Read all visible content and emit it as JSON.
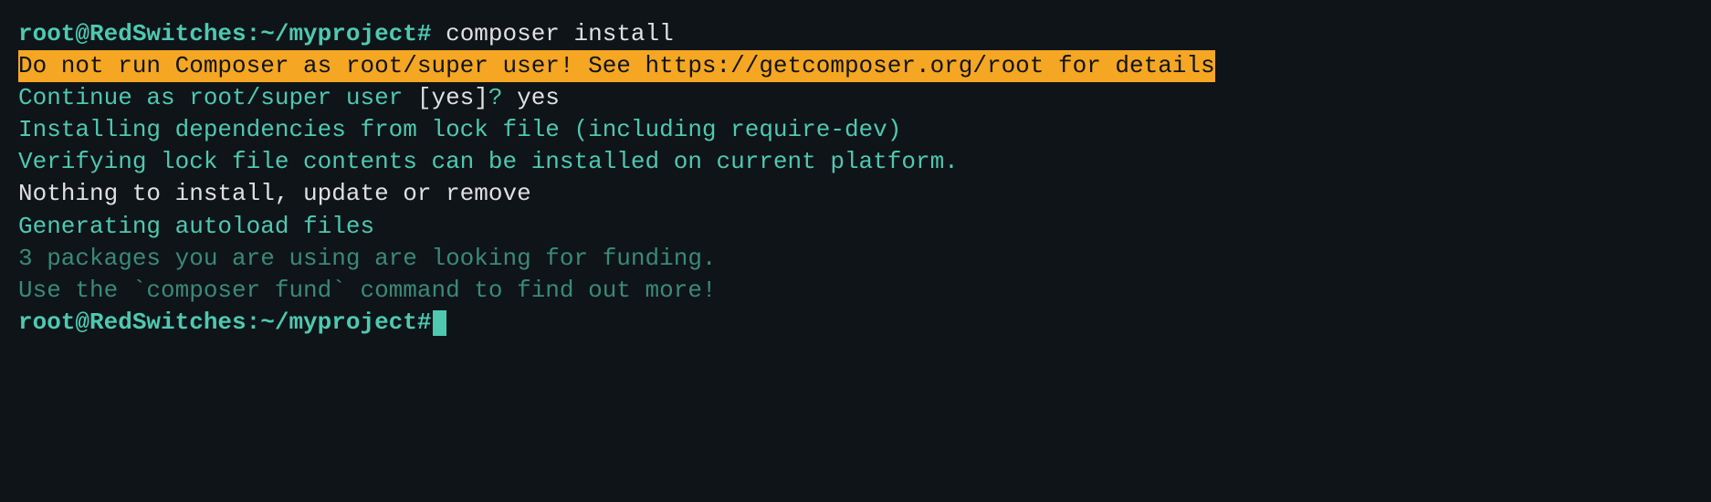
{
  "terminal": {
    "lines": [
      {
        "prompt": "root@RedSwitches",
        "path": ":~/myproject#",
        "command": " composer install"
      },
      {
        "warning": "Do not run Composer as root/super user! See https://getcomposer.org/root for details"
      },
      {
        "question": "Continue as root/super user ",
        "bracket": "[yes]",
        "qmark": "?",
        "answer": " yes"
      },
      {
        "status": "Installing dependencies from lock file (including require-dev)"
      },
      {
        "status": "Verifying lock file contents can be installed on current platform."
      },
      {
        "result": "Nothing to install, update or remove"
      },
      {
        "status": "Generating autoload files"
      },
      {
        "funding1": "3 packages you are using are looking for funding."
      },
      {
        "funding2": "Use the `composer fund` command to find out more!"
      },
      {
        "prompt": "root@RedSwitches",
        "path": ":~/myproject#",
        "cursor": true
      }
    ]
  }
}
